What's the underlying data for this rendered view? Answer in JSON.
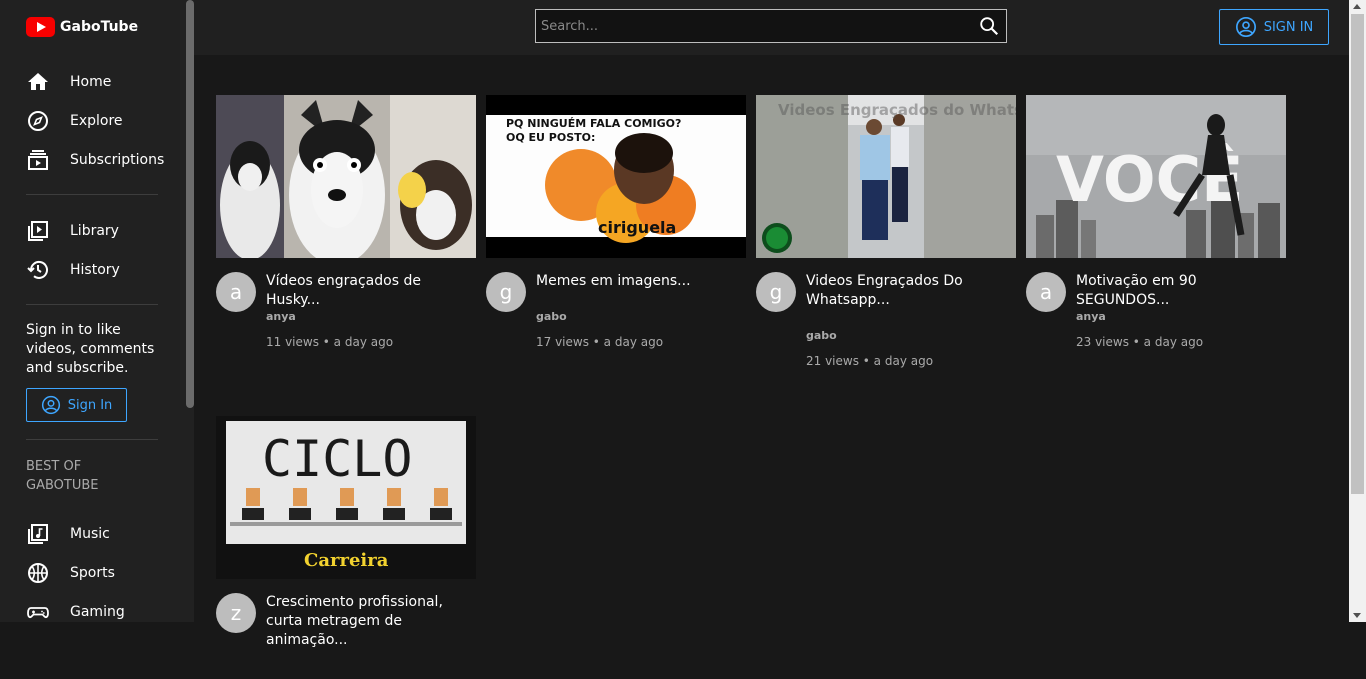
{
  "app": {
    "name": "GaboTube"
  },
  "search": {
    "placeholder": "Search..."
  },
  "header": {
    "sign_in_label": "SIGN IN"
  },
  "sidebar": {
    "primary": [
      {
        "label": "Home",
        "icon": "home-icon"
      },
      {
        "label": "Explore",
        "icon": "compass-icon"
      },
      {
        "label": "Subscriptions",
        "icon": "subscriptions-icon"
      }
    ],
    "secondary": [
      {
        "label": "Library",
        "icon": "library-icon"
      },
      {
        "label": "History",
        "icon": "history-icon"
      }
    ],
    "signin_prompt": "Sign in to like videos, comments and subscribe.",
    "signin_button": "Sign In",
    "best_of_heading": "BEST OF GABOTUBE",
    "best_of": [
      {
        "label": "Music",
        "icon": "music-icon"
      },
      {
        "label": "Sports",
        "icon": "sports-icon"
      },
      {
        "label": "Gaming",
        "icon": "gaming-icon"
      }
    ]
  },
  "videos": [
    {
      "title": "Vídeos engraçados de Husky...",
      "channel": "anya",
      "avatar_letter": "a",
      "stats": "11 views • a day ago"
    },
    {
      "title": "Memes em imagens...",
      "channel": "gabo",
      "avatar_letter": "g",
      "stats": "17 views • a day ago",
      "thumb_text": [
        "PQ NINGUÉM FALA COMIGO?",
        "OQ EU POSTO:",
        "ciriguela"
      ]
    },
    {
      "title": "Videos Engraçados Do Whatsapp...",
      "channel": "gabo",
      "avatar_letter": "g",
      "stats": "21 views • a day ago",
      "thumb_text": [
        "Videos Engraçados do Whatsapp"
      ]
    },
    {
      "title": "Motivação em 90 SEGUNDOS...",
      "channel": "anya",
      "avatar_letter": "a",
      "stats": "23 views • a day ago",
      "thumb_text": [
        "VOCÊ"
      ]
    },
    {
      "title": "Crescimento profissional, curta metragem de animação...",
      "channel": "",
      "avatar_letter": "z",
      "stats": "",
      "thumb_text": [
        "CICLO",
        "Carreira"
      ]
    }
  ],
  "colors": {
    "accent": "#3ea6ff",
    "logo_red": "#f70000",
    "background": "#181818",
    "sidebar": "#212121"
  }
}
